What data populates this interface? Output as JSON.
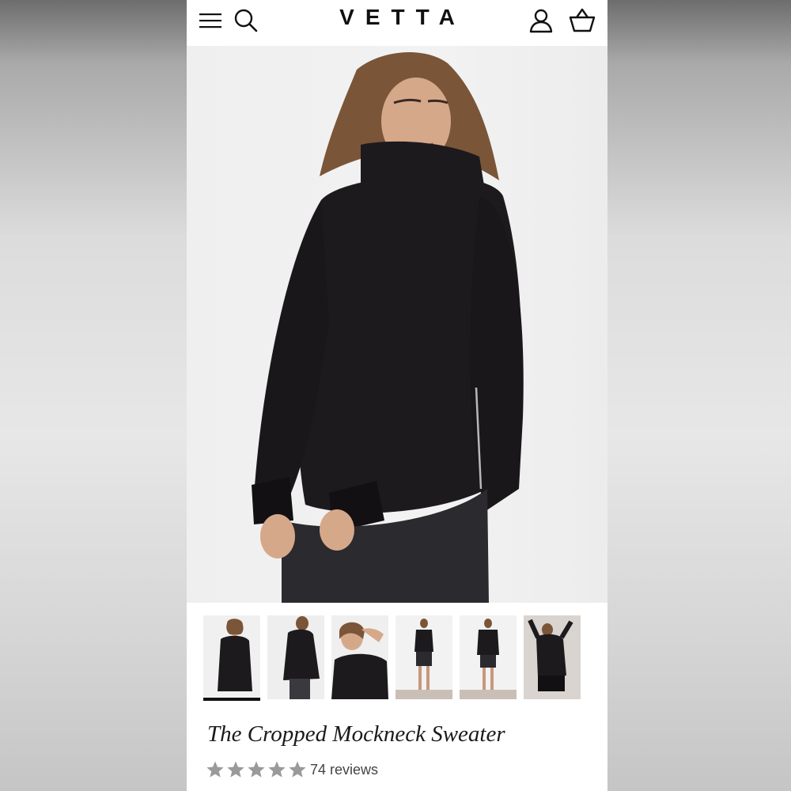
{
  "header": {
    "brand": "VETTA",
    "icons": [
      "menu-icon",
      "search-icon",
      "account-icon",
      "basket-icon"
    ]
  },
  "product": {
    "title": "The Cropped Mockneck Sweater",
    "rating": 5,
    "reviews_label": "74 reviews",
    "thumbnail_count": 6,
    "active_thumbnail": 1
  },
  "colors": {
    "text": "#111111",
    "star": "#9a9a9a",
    "sweater": "#1d1a1e"
  }
}
